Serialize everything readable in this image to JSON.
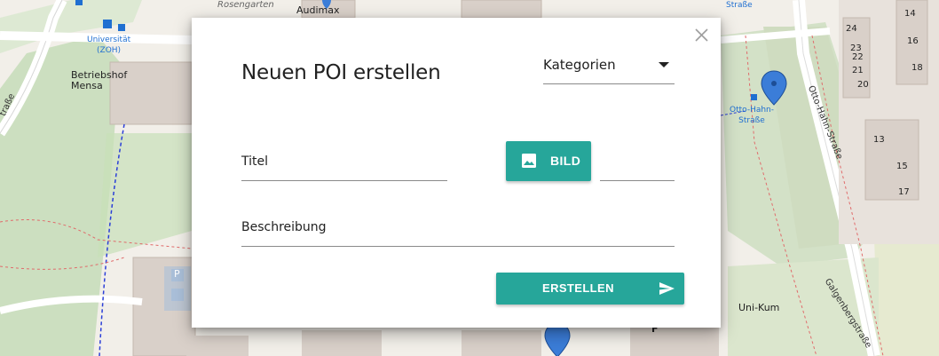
{
  "map": {
    "labels": {
      "universitaet": "Universität\n(ZOH)",
      "betriebshof": "Betriebshof\nMensa",
      "audimax": "Audimax",
      "rosengarten": "Rosengarten",
      "strasse_top": "Straße",
      "otto_hahn_stop": "Otto-Hahn-\nStraße",
      "uni_kum": "Uni-Kum",
      "otto_hahn_street": "Otto-Hahn-Straße",
      "galgenberg": "Galgenbergstraße",
      "left_street": "traße",
      "house_24": "24",
      "house_22": "22",
      "house_20": "20",
      "house_14": "14",
      "house_16": "16",
      "house_18": "18",
      "house_13": "13",
      "house_15": "15",
      "house_17": "17",
      "house_23": "23",
      "house_21": "21",
      "parking_p": "P",
      "letter_f": "F"
    }
  },
  "dialog": {
    "title": "Neuen POI erstellen",
    "category_label": "Kategorien",
    "title_field_label": "Titel",
    "image_button_label": "BILD",
    "description_field_label": "Beschreibung",
    "create_button_label": "ERSTELLEN",
    "accent_color": "#26a69a"
  }
}
